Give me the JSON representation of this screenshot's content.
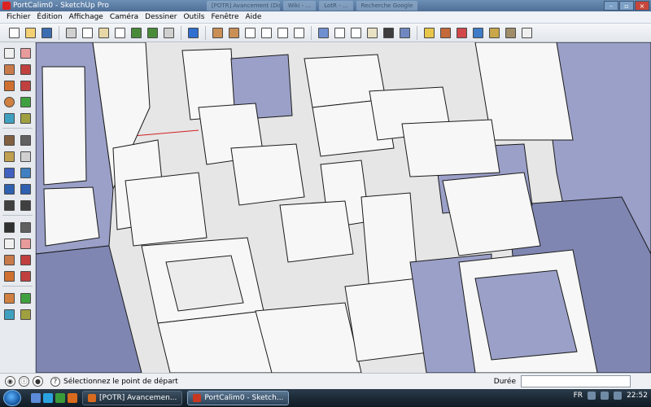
{
  "window": {
    "title": "PortCalim0 - SketchUp Pro",
    "background_tabs": [
      "[POTR] Avancement (Discussion) ...",
      "Wiki - ...",
      "LotR - ...",
      "Recherche Google"
    ]
  },
  "menu": [
    "Fichier",
    "Édition",
    "Affichage",
    "Caméra",
    "Dessiner",
    "Outils",
    "Fenêtre",
    "Aide"
  ],
  "toolbar": {
    "buttons": [
      {
        "name": "new-icon",
        "color": "#ffffff"
      },
      {
        "name": "open-icon",
        "color": "#f2d074"
      },
      {
        "name": "save-icon",
        "color": "#3b6db0"
      },
      {
        "name": "cut-icon",
        "color": "#d0d0d0"
      },
      {
        "name": "copy-icon",
        "color": "#ffffff"
      },
      {
        "name": "paste-icon",
        "color": "#e8d7a6"
      },
      {
        "name": "erase-icon",
        "color": "#ffffff"
      },
      {
        "name": "undo-icon",
        "color": "#4a8b3a"
      },
      {
        "name": "redo-icon",
        "color": "#4a8b3a"
      },
      {
        "name": "print-icon",
        "color": "#cfcfcf"
      },
      {
        "name": "info-icon",
        "color": "#2f6fd0"
      },
      {
        "name": "iso-view-icon",
        "color": "#c98f55"
      },
      {
        "name": "top-view-icon",
        "color": "#c98f55"
      },
      {
        "name": "front-view-icon",
        "color": "#ffffff"
      },
      {
        "name": "right-view-icon",
        "color": "#ffffff"
      },
      {
        "name": "back-view-icon",
        "color": "#ffffff"
      },
      {
        "name": "left-view-icon",
        "color": "#ffffff"
      },
      {
        "name": "xray-icon",
        "color": "#6f8fd0"
      },
      {
        "name": "wireframe-icon",
        "color": "#ffffff"
      },
      {
        "name": "hidden-line-icon",
        "color": "#ffffff"
      },
      {
        "name": "shaded-icon",
        "color": "#e9e1c4"
      },
      {
        "name": "textured-icon",
        "color": "#3e3e3e"
      },
      {
        "name": "monochrome-icon",
        "color": "#7088c0"
      },
      {
        "name": "components-icon",
        "color": "#e8c64a"
      },
      {
        "name": "warehouse-icon",
        "color": "#c46a3a"
      },
      {
        "name": "share-model-icon",
        "color": "#d04848"
      },
      {
        "name": "google-earth-icon",
        "color": "#3f7bc8"
      },
      {
        "name": "get-models-icon",
        "color": "#c9a64a"
      },
      {
        "name": "share-component-icon",
        "color": "#9f8d6a"
      },
      {
        "name": "layers-icon",
        "color": "#f0f0f0"
      }
    ]
  },
  "palette": {
    "tools": [
      [
        "select-icon",
        "eraser-icon"
      ],
      [
        "paint-bucket-icon",
        "eraser-alt-icon"
      ],
      [
        "rectangle-icon",
        "line-icon"
      ],
      [
        "circle-icon",
        "arc-icon"
      ],
      [
        "polygon-icon",
        "freehand-icon"
      ],
      [
        "move-icon",
        "push-pull-icon"
      ],
      [
        "rotate-icon",
        "follow-me-icon"
      ],
      [
        "scale-icon",
        "offset-icon"
      ],
      [
        "tape-measure-icon",
        "dimension-icon"
      ],
      [
        "protractor-icon",
        "text-icon"
      ],
      [
        "axes-icon",
        "3d-text-icon"
      ],
      [
        "orbit-icon",
        "pan-icon"
      ],
      [
        "zoom-icon",
        "zoom-window-icon"
      ],
      [
        "zoom-extents-icon",
        "previous-view-icon"
      ],
      [
        "walk-icon",
        "look-around-icon"
      ],
      [
        "section-plane-icon",
        "position-camera-icon"
      ]
    ]
  },
  "status": {
    "hint": "Sélectionnez le point de départ",
    "measure_label": "Durée",
    "measure_value": ""
  },
  "taskbar": {
    "tasks": [
      {
        "label": "[POTR] Avancemen...",
        "active": false
      },
      {
        "label": "PortCalim0 - Sketch...",
        "active": true
      }
    ],
    "language": "FR",
    "clock": "22:52"
  },
  "colors": {
    "wall_light": "#f7f7f7",
    "wall_shadow": "#9aa0c8",
    "wall_dark": "#7f86b2",
    "ground": "#e6e6e6",
    "edge": "#1a1a1a"
  }
}
